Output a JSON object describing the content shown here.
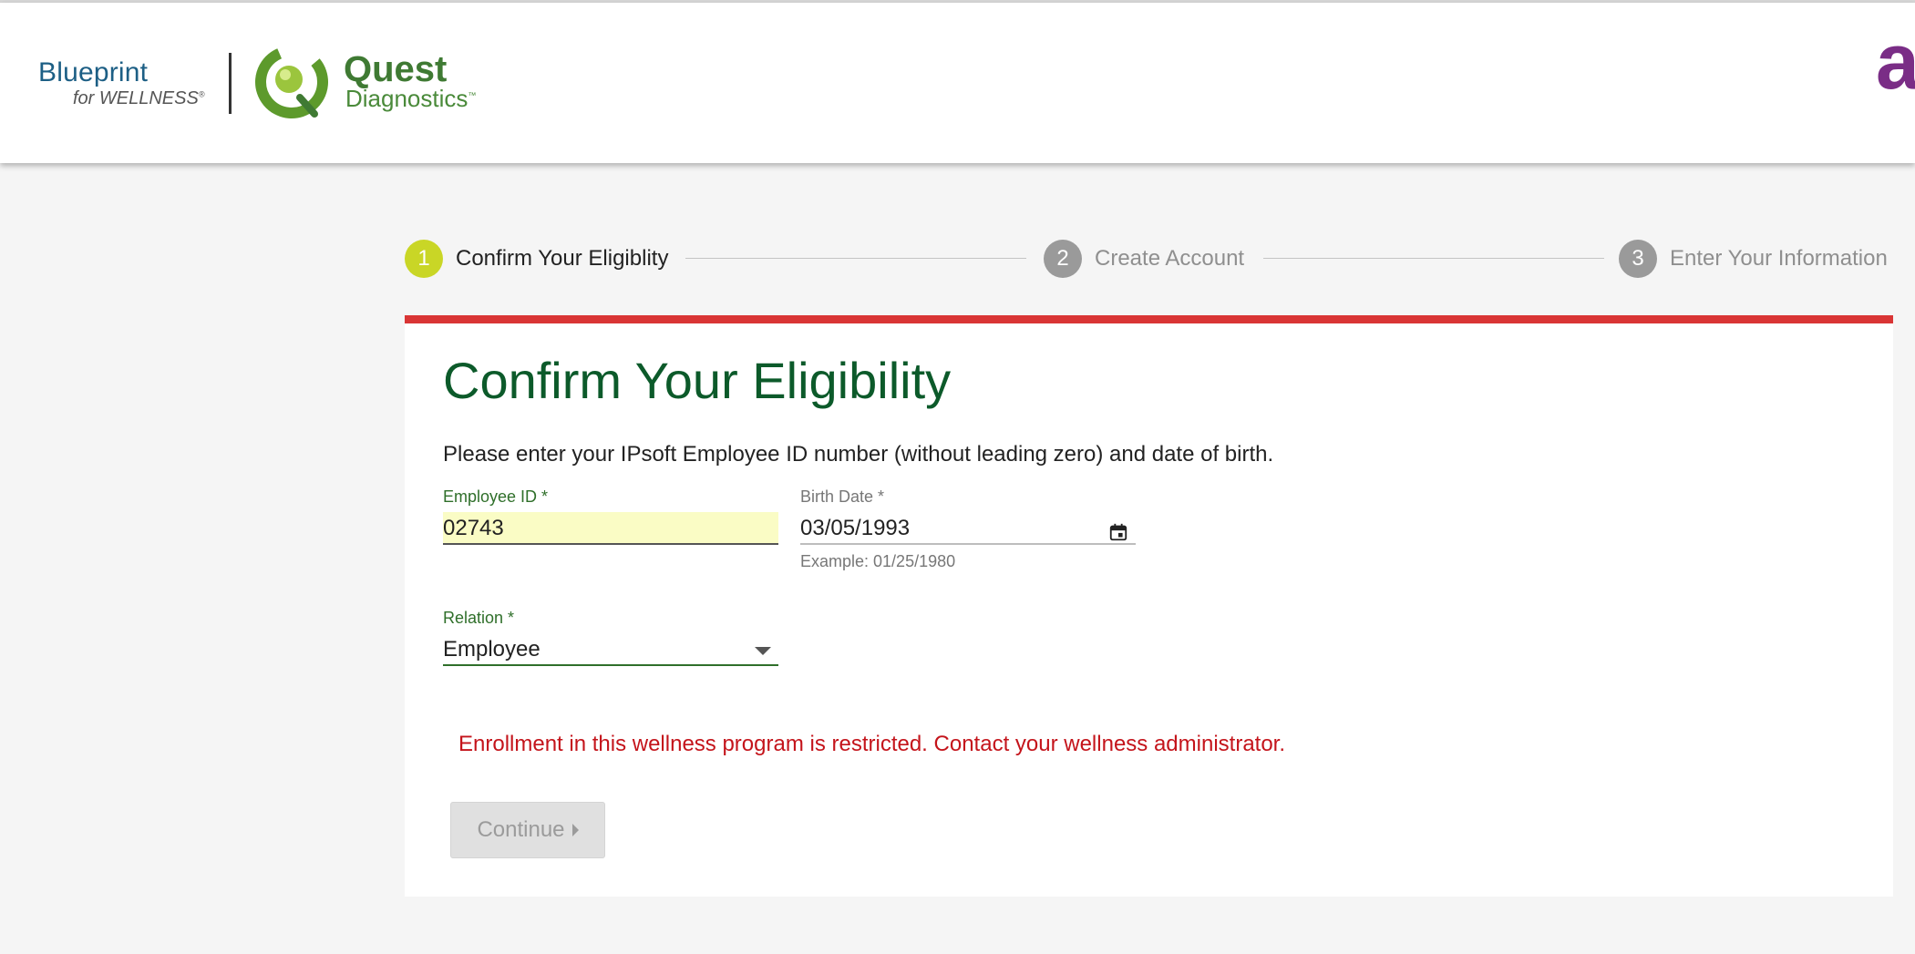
{
  "header": {
    "blueprint_title": "Blueprint",
    "blueprint_sub": "for WELLNESS",
    "quest_word": "Quest",
    "quest_sub": "Diagnostics",
    "corner_letter": "a"
  },
  "stepper": {
    "steps": [
      {
        "number": "1",
        "label": "Confirm Your Eligiblity",
        "state": "active"
      },
      {
        "number": "2",
        "label": "Create Account",
        "state": "inactive"
      },
      {
        "number": "3",
        "label": "Enter Your Information",
        "state": "inactive"
      }
    ]
  },
  "form": {
    "title": "Confirm Your Eligibility",
    "instructions": "Please enter your IPsoft Employee ID number (without leading zero) and date of birth.",
    "employee_id": {
      "label": "Employee ID *",
      "value": "02743"
    },
    "birth_date": {
      "label": "Birth Date *",
      "value": "03/05/1993",
      "help": "Example: 01/25/1980"
    },
    "relation": {
      "label": "Relation *",
      "value": "Employee"
    },
    "error": "Enrollment in this wellness program is restricted. Contact your wellness administrator.",
    "continue_label": "Continue"
  },
  "colors": {
    "accent_red": "#d93535",
    "title_green": "#0c5a2a",
    "active_step": "#c9d626",
    "error_red": "#c4141b",
    "autofill_yellow": "#fafcc5"
  },
  "icons": {
    "calendar": "calendar-icon",
    "dropdown": "chevron-down-icon",
    "continue": "caret-right-icon"
  }
}
